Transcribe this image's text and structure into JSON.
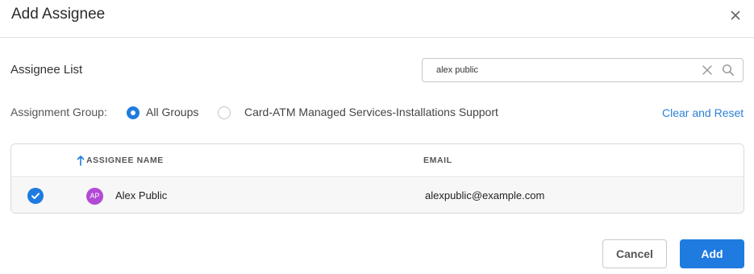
{
  "dialog": {
    "title": "Add Assignee",
    "close_icon": "close-icon"
  },
  "section": {
    "title": "Assignee List"
  },
  "search": {
    "value": "alex public",
    "clear_icon": "clear-icon",
    "search_icon": "search-icon"
  },
  "assignment_group": {
    "label": "Assignment Group:",
    "options": [
      {
        "label": "All Groups",
        "selected": true
      },
      {
        "label": "Card-ATM Managed Services-Installations Support",
        "selected": false
      }
    ],
    "clear_reset_label": "Clear and Reset"
  },
  "table": {
    "columns": [
      "ASSIGNEE NAME",
      "EMAIL"
    ],
    "sort_icon": "sort-ascending-icon",
    "rows": [
      {
        "selected": true,
        "avatar_initials": "AP",
        "name": "Alex Public",
        "email": "alexpublic@example.com"
      }
    ]
  },
  "footer": {
    "cancel_label": "Cancel",
    "add_label": "Add"
  },
  "colors": {
    "accent": "#1f7be0",
    "link": "#2a82d8",
    "avatar": "#b14ad6"
  }
}
